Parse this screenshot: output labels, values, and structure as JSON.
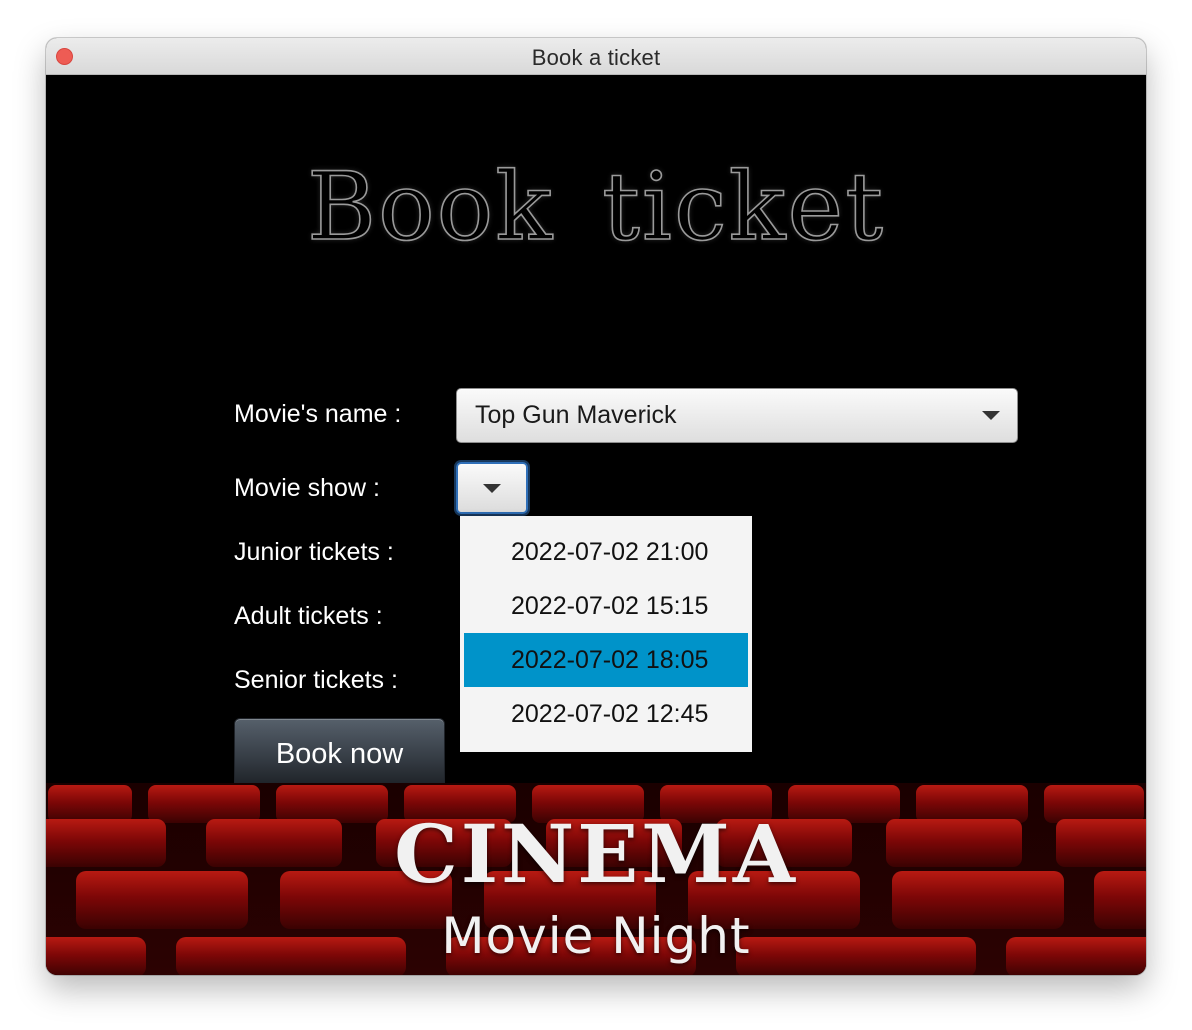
{
  "window": {
    "title": "Book a ticket"
  },
  "heading": "Book ticket",
  "form": {
    "movie_label": "Movie's name :",
    "movie_value": "Top Gun Maverick",
    "show_label": "Movie show :",
    "junior_label": "Junior tickets :",
    "adult_label": "Adult tickets :",
    "senior_label": "Senior tickets :",
    "book_button": "Book now"
  },
  "show_dropdown": {
    "options": [
      "2022-07-02 21:00",
      "2022-07-02 15:15",
      "2022-07-02 18:05",
      "2022-07-02 12:45"
    ],
    "highlighted": "2022-07-02 18:05"
  },
  "banner": {
    "title": "CINEMA",
    "subtitle": "Movie Night"
  },
  "colors": {
    "background": "#000000",
    "highlight": "#0093c9",
    "seat_red": "#8e0a0a",
    "close_button": "#ee5c54"
  },
  "icons": {
    "close": "close-icon",
    "dropdown": "chevron-down-icon"
  }
}
